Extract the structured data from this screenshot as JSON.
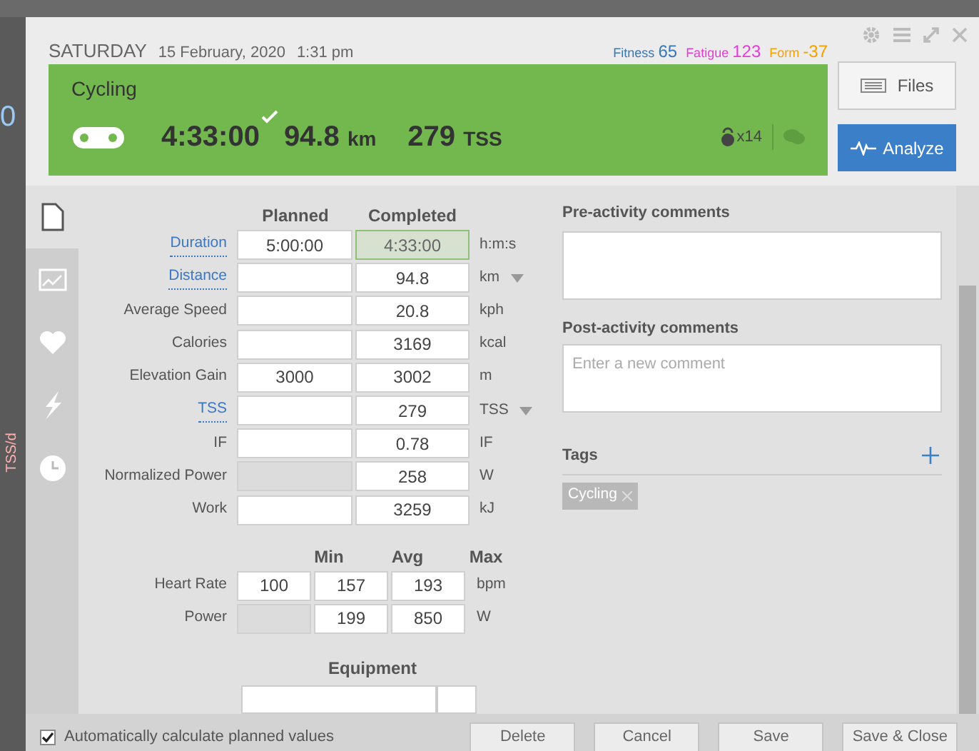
{
  "background": {
    "number": "0",
    "axis_label": "TSS/d"
  },
  "header": {
    "day": "SATURDAY",
    "date": "15 February, 2020",
    "time": "1:31 pm",
    "metrics": [
      {
        "label": "Fitness",
        "value": "65",
        "color": "#3a78b5"
      },
      {
        "label": "Fatigue",
        "value": "123",
        "color": "#e83ad8"
      },
      {
        "label": "Form",
        "value": "-37",
        "color": "#f5a100"
      }
    ]
  },
  "workout": {
    "sport": "Cycling",
    "duration": "4:33:00",
    "completed": true,
    "distance": "94.8",
    "distance_unit": "km",
    "tss": "279",
    "tss_unit": "TSS",
    "count": "x14"
  },
  "side_buttons": [
    {
      "label": "Files",
      "kind": "files"
    },
    {
      "label": "Analyze",
      "kind": "analyze"
    }
  ],
  "rail_tabs": [
    {
      "kind": "document",
      "selected": true
    },
    {
      "kind": "chart",
      "selected": false
    },
    {
      "kind": "heart",
      "selected": false
    },
    {
      "kind": "bolt",
      "selected": false
    },
    {
      "kind": "clock",
      "selected": false
    }
  ],
  "form": {
    "columns": [
      "Planned",
      "Completed"
    ],
    "rows": [
      {
        "label": "Duration",
        "link": true,
        "planned": "5:00:00",
        "planned_disabled": false,
        "completed": "4:33:00",
        "completed_active": true,
        "unit": "h:m:s",
        "unit_menu": false
      },
      {
        "label": "Distance",
        "link": true,
        "planned": "",
        "planned_disabled": false,
        "completed": "94.8",
        "completed_active": false,
        "unit": "km",
        "unit_menu": true
      },
      {
        "label": "Average Speed",
        "link": false,
        "planned": "",
        "planned_disabled": false,
        "completed": "20.8",
        "completed_active": false,
        "unit": "kph",
        "unit_menu": false
      },
      {
        "label": "Calories",
        "link": false,
        "planned": "",
        "planned_disabled": false,
        "completed": "3169",
        "completed_active": false,
        "unit": "kcal",
        "unit_menu": false
      },
      {
        "label": "Elevation Gain",
        "link": false,
        "planned": "3000",
        "planned_disabled": false,
        "completed": "3002",
        "completed_active": false,
        "unit": "m",
        "unit_menu": false
      },
      {
        "label": "TSS",
        "link": true,
        "planned": "",
        "planned_disabled": false,
        "completed": "279",
        "completed_active": false,
        "unit": "TSS",
        "unit_menu": true
      },
      {
        "label": "IF",
        "link": false,
        "planned": "",
        "planned_disabled": false,
        "completed": "0.78",
        "completed_active": false,
        "unit": "IF",
        "unit_menu": false
      },
      {
        "label": "Normalized Power",
        "link": false,
        "planned": "",
        "planned_disabled": true,
        "completed": "258",
        "completed_active": false,
        "unit": "W",
        "unit_menu": false
      },
      {
        "label": "Work",
        "link": false,
        "planned": "",
        "planned_disabled": false,
        "completed": "3259",
        "completed_active": false,
        "unit": "kJ",
        "unit_menu": false
      }
    ],
    "range_columns": [
      "Min",
      "Avg",
      "Max"
    ],
    "range_rows": [
      {
        "label": "Heart Rate",
        "min": "100",
        "min_disabled": false,
        "avg": "157",
        "max": "193",
        "unit": "bpm"
      },
      {
        "label": "Power",
        "min": "",
        "min_disabled": true,
        "avg": "199",
        "max": "850",
        "unit": "W"
      }
    ],
    "equipment_title": "Equipment"
  },
  "comments": {
    "pre_title": "Pre-activity comments",
    "post_title": "Post-activity comments",
    "post_placeholder": "Enter a new comment"
  },
  "tags": {
    "title": "Tags",
    "items": [
      "Cycling"
    ]
  },
  "footer": {
    "auto_calc": {
      "label": "Automatically calculate planned values",
      "checked": true
    },
    "buttons": [
      "Delete",
      "Cancel",
      "Save",
      "Save & Close"
    ]
  }
}
